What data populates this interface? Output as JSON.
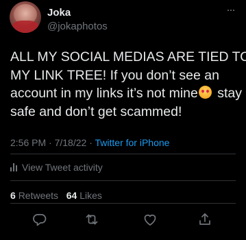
{
  "user": {
    "display_name": "Joka",
    "handle": "@jokaphotos"
  },
  "tweet": {
    "lines": [
      "ALL MY SOCIAL MEDIAS ARE TIED TO",
      "MY LINK TREE! If you don’t see an",
      "account in my links it’s not mine",
      " stay",
      "safe and don’t get scammed!"
    ],
    "emoji": "smiling-face-with-hearts-icon"
  },
  "meta": {
    "time": "2:56 PM",
    "separator1": " · ",
    "date": "7/18/22",
    "separator2": " · ",
    "source": "Twitter for iPhone"
  },
  "activity": {
    "label": "View Tweet activity"
  },
  "stats": {
    "retweets_count": "6",
    "retweets_label": "Retweets",
    "likes_count": "64",
    "likes_label": "Likes"
  },
  "actions": {
    "reply_icon": "reply-icon",
    "retweet_icon": "retweet-icon",
    "like_icon": "like-icon",
    "share_icon": "share-icon"
  },
  "colors": {
    "background": "#000000",
    "text": "#e7e9ea",
    "secondary": "#71767b",
    "link": "#1d9bf0",
    "divider": "#2f3336"
  }
}
